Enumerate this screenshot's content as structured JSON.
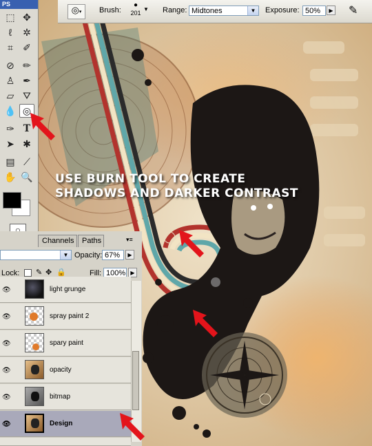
{
  "app": {
    "badge": "PS"
  },
  "options_bar": {
    "brush_label": "Brush:",
    "brush_size": "201",
    "range_label": "Range:",
    "range_value": "Midtones",
    "exposure_label": "Exposure:",
    "exposure_value": "50%"
  },
  "annotation": {
    "line1": "USE BURN TOOL TO CREATE",
    "line2": "SHADOWS AND DARKER CONTRAST"
  },
  "layers_panel": {
    "tabs": [
      {
        "label": "Channels"
      },
      {
        "label": "Paths"
      }
    ],
    "opacity_label": "Opacity:",
    "opacity_value": "67%",
    "lock_label": "Lock:",
    "fill_label": "Fill:",
    "fill_value": "100%",
    "layers": [
      {
        "name": "light grunge",
        "selected": false
      },
      {
        "name": "spray paint 2",
        "selected": false
      },
      {
        "name": "spary paint",
        "selected": false
      },
      {
        "name": "opacity",
        "selected": false
      },
      {
        "name": "bitmap",
        "selected": false
      },
      {
        "name": "Design",
        "selected": true
      }
    ]
  },
  "icons": [
    "dodge-burn-icon",
    "marquee-icon",
    "move-icon",
    "lasso-icon",
    "magic-wand-icon",
    "crop-icon",
    "slice-icon",
    "healing-icon",
    "brush-icon",
    "stamp-icon",
    "history-brush-icon",
    "eraser-icon",
    "paint-bucket-icon",
    "blur-icon",
    "burn-tool-icon",
    "pen-icon",
    "type-icon",
    "path-select-icon",
    "shape-icon",
    "notes-icon",
    "eyedropper-icon",
    "hand-icon",
    "zoom-icon",
    "eye-icon"
  ],
  "colors": {
    "accent_arrow": "#e3141b",
    "selection": "#a9a9ba",
    "titlebar": "#3860b0"
  }
}
